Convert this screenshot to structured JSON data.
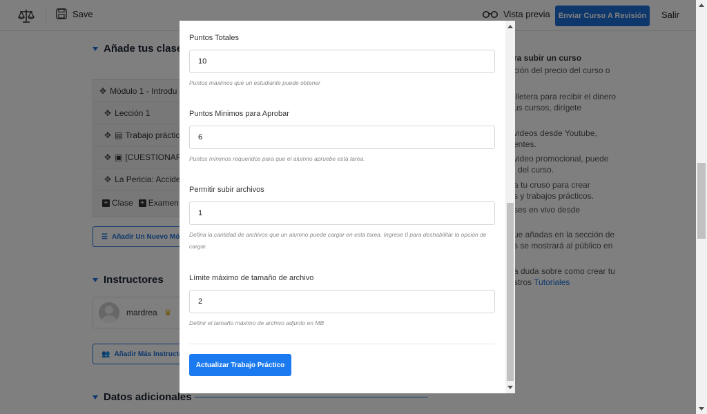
{
  "topbar": {
    "save_label": "Save",
    "preview_label": "Vista previa",
    "submit_label": "Enviar Curso A Revisión",
    "exit_label": "Salir"
  },
  "background": {
    "section_classes": "Añade tus clases",
    "modules": [
      "Módulo 1 - Introdu",
      "Lección 1",
      "Trabajo práctic",
      "[CUESTIONARIO",
      "La Pericia: Accider"
    ],
    "add_class_label": "Clase",
    "add_exam_label": "Examen",
    "add_module_label": "Añadir Un Nuevo Mód",
    "section_instructors": "Instructores",
    "instructor_name": "mardrea",
    "add_instructors_label": "Añadir Más Instructor",
    "section_additional": "Datos adicionales",
    "tips": {
      "heading": "ra subir un curso",
      "lines": [
        "ción del precio del curso o",
        "illetera para recibir el dinero",
        "us cursos, dirígete",
        "videos desde Youtube,",
        "entes.",
        "video promocional, puede",
        "l del curso.",
        "a tu cruso para crear",
        "s y trabajos prácticos.",
        "ses en vivo desde",
        "ue añadas en la sección de",
        "s se mostrará al público en",
        "a duda sobre como crear tu",
        "stros"
      ],
      "link": "Tutoriales"
    }
  },
  "modal": {
    "fields": [
      {
        "label": "Puntos Totales",
        "value": "10",
        "hint": "Puntos máximos que un estudiante puede obtener"
      },
      {
        "label": "Puntos Minimos para Aprobar",
        "value": "6",
        "hint": "Puntos mínimos requeridos para que el alumno apruebe esta tarea."
      },
      {
        "label": "Permitir subir archivos",
        "value": "1",
        "hint": "Defina la cantidad de archivos que un alumno puede cargar en esta tarea. Ingrese 0 para deshabilitar la opción de cargar."
      },
      {
        "label": "Límite máximo de tamaño de archivo",
        "value": "2",
        "hint": "Definir el tamaño máximo de archivo adjunto en MB"
      }
    ],
    "submit_label": "Actualizar Trabajo Práctico"
  },
  "colors": {
    "accent": "#1c6fd9",
    "modal_button": "#1c7af0",
    "overlay": "rgba(0,0,0,0.5)"
  }
}
